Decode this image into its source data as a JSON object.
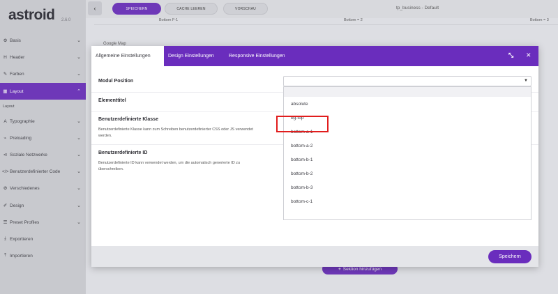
{
  "sidebar": {
    "logo": "astroid",
    "version": "2.6.0",
    "items": [
      {
        "icon": "⚙",
        "label": "Basis"
      },
      {
        "icon": "H",
        "label": "Header"
      },
      {
        "icon": "✎",
        "label": "Farben"
      },
      {
        "icon": "▦",
        "label": "Layout"
      },
      {
        "icon": "A",
        "label": "Typographie"
      },
      {
        "icon": "⌁",
        "label": "Preloading"
      },
      {
        "icon": "⊲",
        "label": "Soziale Netzwerke"
      },
      {
        "icon": "</>",
        "label": "Benutzerdefinierter Code"
      },
      {
        "icon": "⚙",
        "label": "Verschiedenes"
      },
      {
        "icon": "✐",
        "label": "Design"
      },
      {
        "icon": "☰",
        "label": "Preset Profiles"
      },
      {
        "icon": "⤓",
        "label": "Exportieren"
      },
      {
        "icon": "⤒",
        "label": "Importieren"
      }
    ],
    "sub_label": "Layout"
  },
  "topbar": {
    "save_label": "SPEICHERN",
    "cache_label": "CACHE LEEREN",
    "preview_label": "VORSCHAU",
    "page_title": "tp_business - Default"
  },
  "canvas": {
    "positions": [
      "Bottom F-1",
      "Bottom = 2",
      "Bottom = 3"
    ],
    "google_map": "Google Map",
    "add_section": "Sektion hinzufügen"
  },
  "modal": {
    "tabs": [
      "Allgemeine Einstellungen",
      "Design Einstellungen",
      "Responsive Einstellungen"
    ],
    "fields": {
      "module_position": "Modul Position",
      "element_title": "Elementtitel",
      "custom_class": "Benutzerdefinierte Klasse",
      "custom_class_help": "Benutzerdefinierte Klasse kann zum Schreiben benutzerdefinierter CSS oder JS verwendet werden.",
      "custom_id": "Benutzerdefinierte ID",
      "custom_id_help": "Benutzerdefinierte ID kann verwendet werden, um die automatisch generierte ID zu überschreiben."
    },
    "dropdown_options": [
      "absolute",
      "bg-top",
      "bottom-a-1",
      "bottom-a-2",
      "bottom-b-1",
      "bottom-b-2",
      "bottom-b-3",
      "bottom-c-1"
    ],
    "save_label": "Speichern"
  },
  "colors": {
    "accent": "#6a2dbd",
    "highlight": "#e11d1d"
  }
}
